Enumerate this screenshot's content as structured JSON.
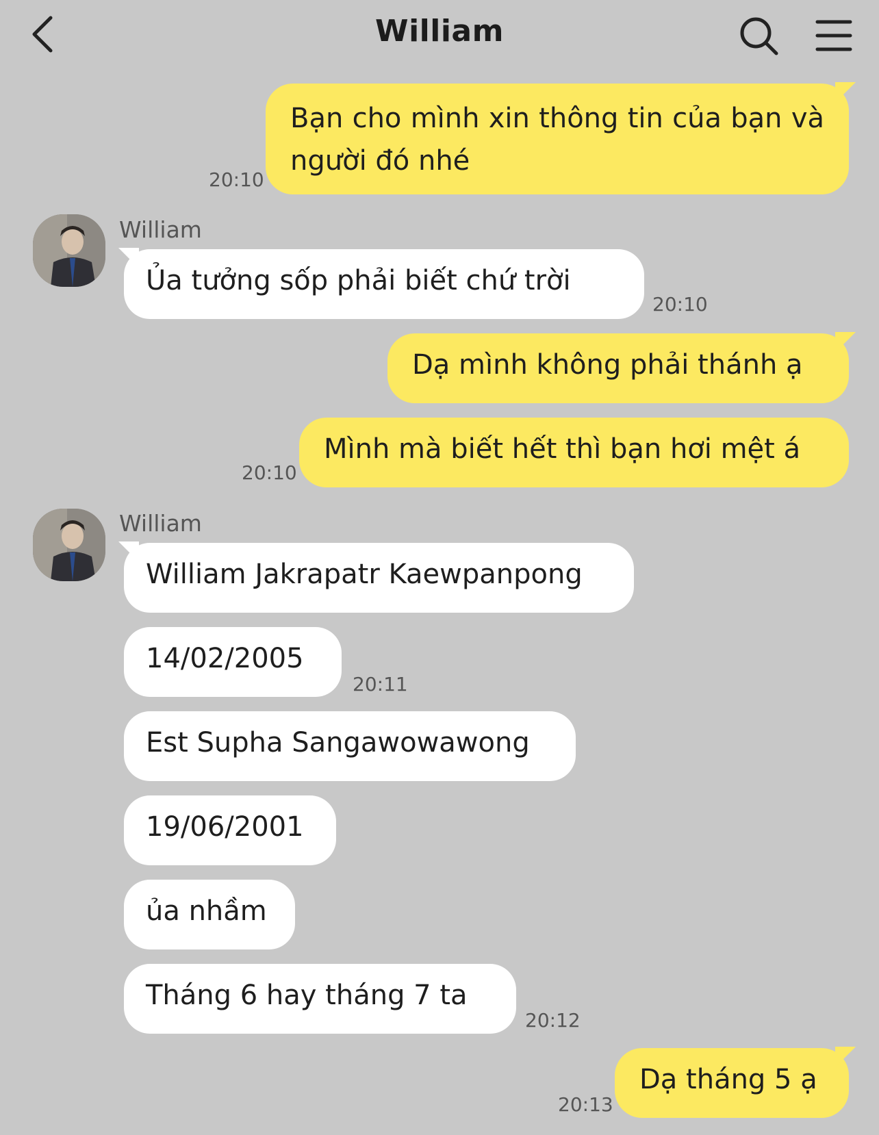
{
  "header": {
    "title": "William"
  },
  "contact": {
    "name": "William"
  },
  "messages": [
    {
      "text": "Bạn cho mình xin thông tin của bạn và người đó nhé",
      "time": "20:10"
    },
    {
      "text": "Ủa tưởng sốp phải biết chứ trời",
      "time": "20:10"
    },
    {
      "text": "Dạ mình không phải thánh ạ"
    },
    {
      "text": "Mình mà biết hết thì bạn hơi mệt á",
      "time": "20:10"
    },
    {
      "text": "William Jakrapatr Kaewpanpong"
    },
    {
      "text": "14/02/2005",
      "time": "20:11"
    },
    {
      "text": "Est Supha Sangawowawong"
    },
    {
      "text": "19/06/2001"
    },
    {
      "text": "ủa nhầm"
    },
    {
      "text": "Tháng 6 hay tháng 7 ta",
      "time": "20:12"
    },
    {
      "text": "Dạ tháng 5 ạ",
      "time": "20:13"
    }
  ],
  "colors": {
    "background": "#c8c8c8",
    "outgoing": "#fce961",
    "incoming": "#ffffff"
  },
  "icons": [
    "back-arrow-icon",
    "search-icon",
    "menu-icon"
  ]
}
